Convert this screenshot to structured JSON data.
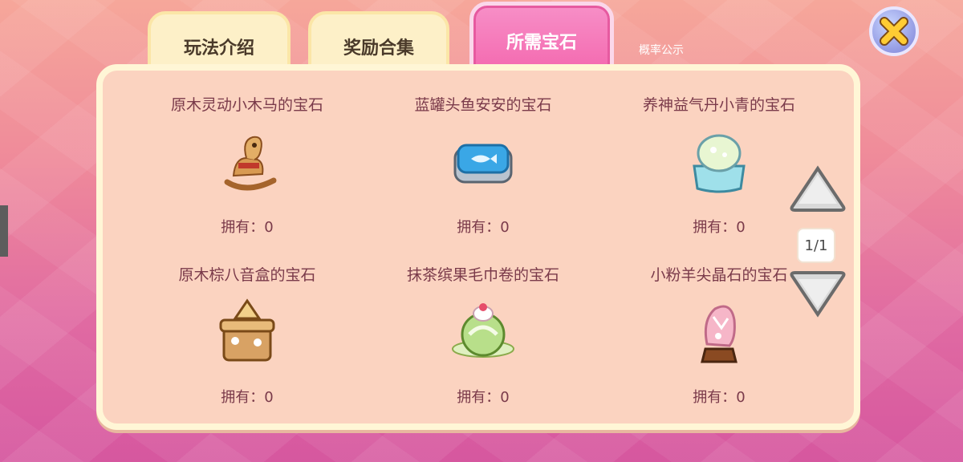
{
  "tabs": [
    {
      "label": "玩法介绍"
    },
    {
      "label": "奖励合集"
    },
    {
      "label": "所需宝石"
    }
  ],
  "extra_link": "概率公示",
  "gems": [
    {
      "name": "原木灵动小木马的宝石",
      "owned": "拥有：0",
      "icon": "wooden-horse-icon"
    },
    {
      "name": "蓝罐头鱼安安的宝石",
      "owned": "拥有：0",
      "icon": "fish-can-icon"
    },
    {
      "name": "养神益气丹小青的宝石",
      "owned": "拥有：0",
      "icon": "elixir-pill-icon"
    },
    {
      "name": "原木棕八音盒的宝石",
      "owned": "拥有：0",
      "icon": "music-box-icon"
    },
    {
      "name": "抹茶缤果毛巾卷的宝石",
      "owned": "拥有：0",
      "icon": "matcha-roll-icon"
    },
    {
      "name": "小粉羊尖晶石的宝石",
      "owned": "拥有：0",
      "icon": "pink-crystal-icon"
    }
  ],
  "pager": {
    "page": "1/1"
  },
  "colors": {
    "active_tab": "#f46ab0",
    "panel_bg": "#fbd3c0",
    "text": "#7a3a4a"
  }
}
